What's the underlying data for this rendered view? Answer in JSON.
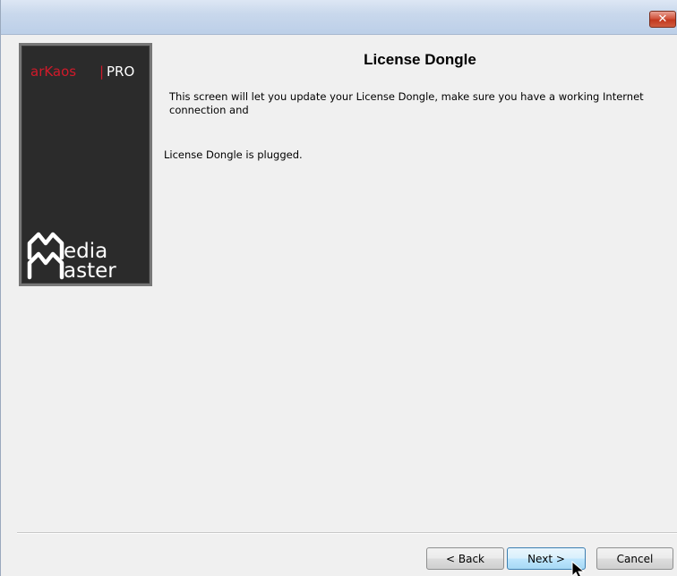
{
  "window": {
    "close_glyph": "✕"
  },
  "logo": {
    "brand_part1": "arKaos",
    "brand_separator": "|",
    "brand_part2": "PRO",
    "product_line1": "edia",
    "product_line2": "aster",
    "accent_color": "#d11a2a",
    "panel_color": "#2b2b2b"
  },
  "page": {
    "title": "License Dongle",
    "description": "This screen will let you update your License Dongle, make sure you have a working Internet connection and",
    "status": "License Dongle is plugged."
  },
  "buttons": {
    "back": "< Back",
    "next": "Next >",
    "cancel": "Cancel"
  }
}
